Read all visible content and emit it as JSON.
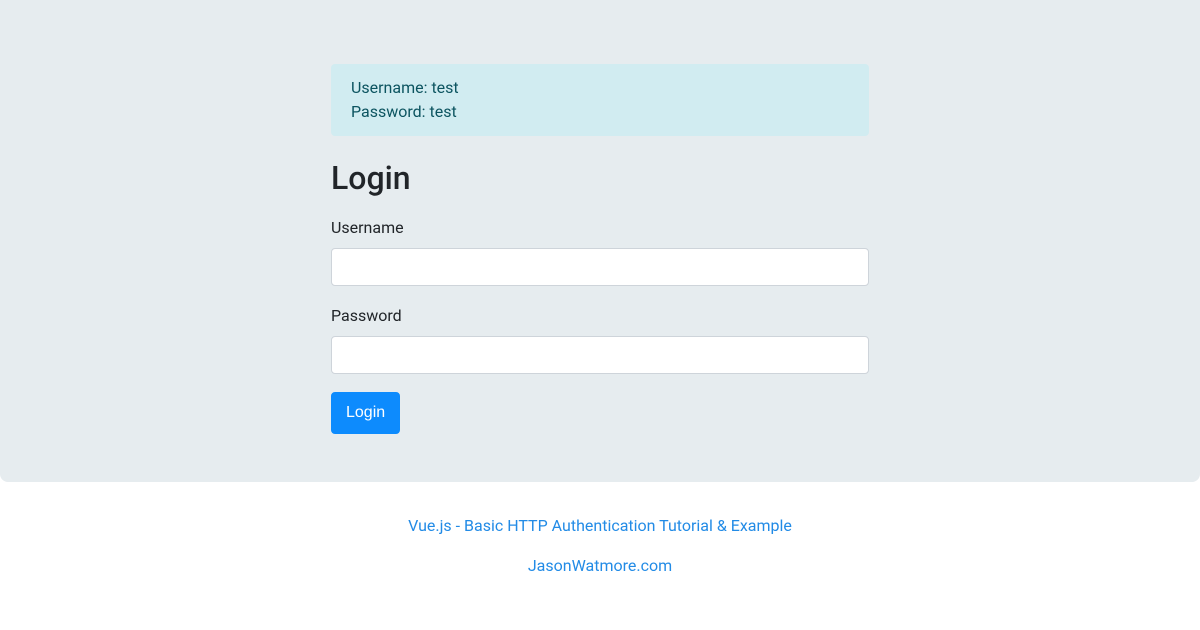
{
  "alert": {
    "line1": "Username: test",
    "line2": "Password: test"
  },
  "heading": "Login",
  "form": {
    "username_label": "Username",
    "username_value": "",
    "password_label": "Password",
    "password_value": "",
    "submit_label": "Login"
  },
  "footer": {
    "link1_text": "Vue.js - Basic HTTP Authentication Tutorial & Example",
    "link2_text": "JasonWatmore.com"
  }
}
